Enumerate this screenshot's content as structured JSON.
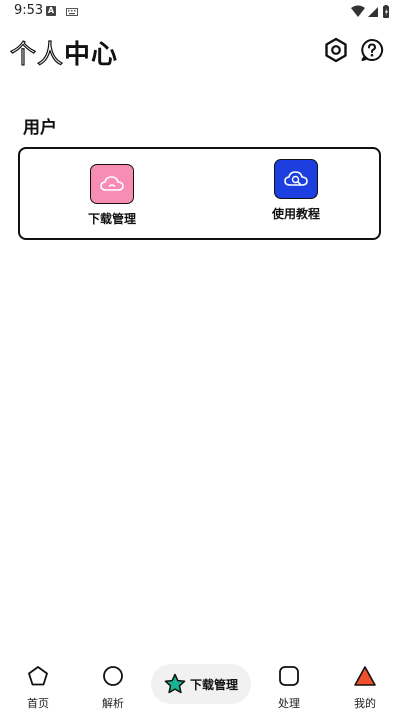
{
  "status_bar": {
    "time": "9:53",
    "notification_badge": "A",
    "icons": [
      "keyboard-icon",
      "wifi-icon",
      "signal-icon",
      "battery-icon"
    ]
  },
  "header": {
    "title_outline": "个人",
    "title_solid": "中心",
    "actions": [
      "settings-icon",
      "help-icon"
    ]
  },
  "user_section": {
    "label": "用户",
    "items": [
      {
        "label": "下载管理",
        "icon": "cloud-icon",
        "color": "#f78cb4"
      },
      {
        "label": "使用教程",
        "icon": "cloud-search-icon",
        "color": "#1d3fe0"
      }
    ]
  },
  "bottom_nav": {
    "items": [
      {
        "label": "首页",
        "icon": "pentagon-icon"
      },
      {
        "label": "解析",
        "icon": "circle-icon"
      },
      {
        "label": "下载管理",
        "icon": "star-icon",
        "active": true,
        "color": "#19b394"
      },
      {
        "label": "处理",
        "icon": "rounded-square-icon"
      },
      {
        "label": "我的",
        "icon": "triangle-icon",
        "color": "#f0502a"
      }
    ]
  }
}
